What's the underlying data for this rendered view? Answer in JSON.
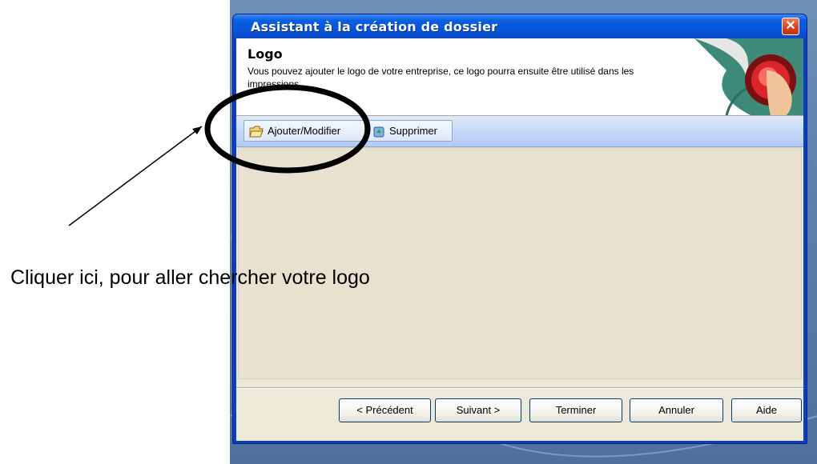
{
  "window": {
    "title": "Assistant à la création de dossier",
    "close_glyph": "✕"
  },
  "header": {
    "title": "Logo",
    "description": "Vous pouvez ajouter le logo de votre entreprise, ce logo pourra ensuite être utilisé dans les impressions.",
    "art_icon": "red-push-button-icon"
  },
  "toolbar": {
    "add_label": "Ajouter/Modifier",
    "add_icon": "open-folder-icon",
    "delete_label": "Supprimer",
    "delete_icon": "recycle-bin-icon"
  },
  "buttons": {
    "previous": "< Précédent",
    "next": "Suivant >",
    "finish": "Terminer",
    "cancel": "Annuler",
    "help": "Aide"
  },
  "annotation": {
    "caption": "Cliquer ici, pour aller chercher votre logo"
  },
  "colors": {
    "titlebar": "#0654d8",
    "toolbar": "#c4d8f6",
    "client": "#ece9d8",
    "close": "#d9401c"
  }
}
